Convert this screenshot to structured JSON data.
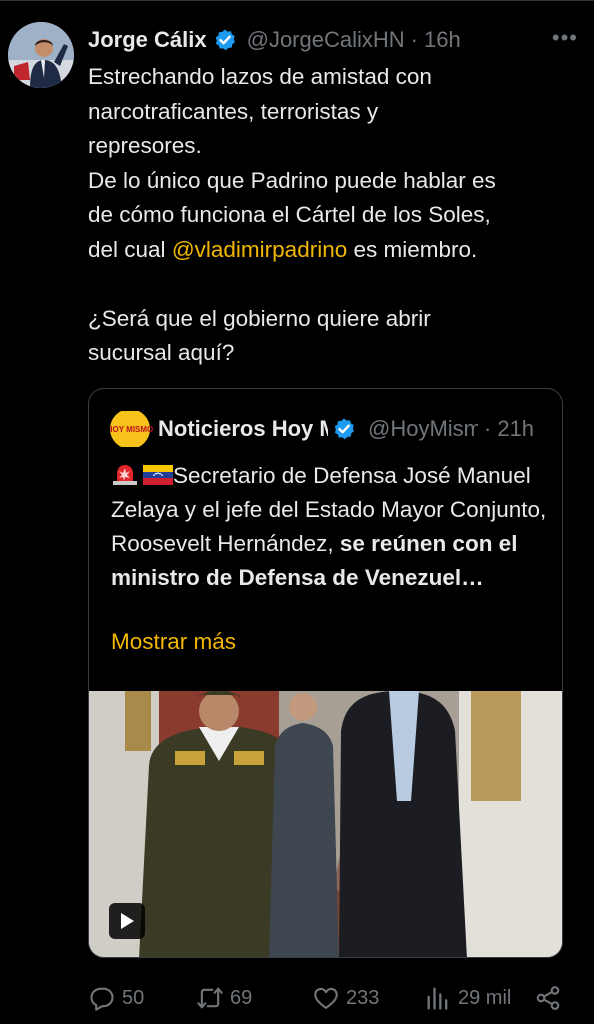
{
  "tweet": {
    "author_name": "Jorge Cálix",
    "handle": "@JorgeCalixHN",
    "separator": "·",
    "time": "16h",
    "more": "•••",
    "text_lines": [
      "Estrechando lazos de amistad con",
      "narcotraficantes, terroristas y",
      "represores.",
      "De lo único que Padrino puede hablar es",
      "de cómo funciona el Cártel de los Soles,"
    ],
    "line6_before": "del cual ",
    "mention": "@vladimirpadrino",
    "line6_after": " es miembro.",
    "question_lines": [
      "¿Será que el gobierno quiere abrir",
      "sucursal aquí?"
    ]
  },
  "quote": {
    "avatar_text": "HOY MISMO",
    "name": "Noticieros Hoy Mismo",
    "handle": "@HoyMismo",
    "separator": "·",
    "time": "21h",
    "text_plain": "Secretario de Defensa José Manuel Zelaya y el jefe del Estado Mayor Conjunto, Roosevelt Hernández, ",
    "text_bold": "se reúnen con el ministro de Defensa de Venezuel…",
    "show_more": "Mostrar más"
  },
  "actions": {
    "replies": "50",
    "reposts": "69",
    "likes": "233",
    "views": "29 mil"
  },
  "colors": {
    "background": "#000000",
    "text": "#e7e9ea",
    "muted": "#71767b",
    "mention": "#f2b705",
    "verified": "#1d9bf0"
  }
}
